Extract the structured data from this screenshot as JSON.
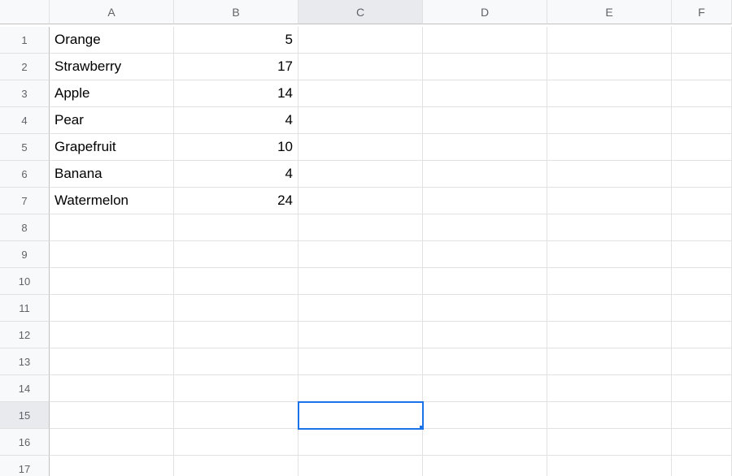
{
  "columns": [
    "A",
    "B",
    "C",
    "D",
    "E",
    "F"
  ],
  "rowCount": 17,
  "activeCell": {
    "col": "C",
    "row": 15
  },
  "cells": {
    "A1": {
      "v": "Orange",
      "t": "txt"
    },
    "B1": {
      "v": "5",
      "t": "num"
    },
    "A2": {
      "v": "Strawberry",
      "t": "txt"
    },
    "B2": {
      "v": "17",
      "t": "num"
    },
    "A3": {
      "v": "Apple",
      "t": "txt"
    },
    "B3": {
      "v": "14",
      "t": "num"
    },
    "A4": {
      "v": "Pear",
      "t": "txt"
    },
    "B4": {
      "v": "4",
      "t": "num"
    },
    "A5": {
      "v": "Grapefruit",
      "t": "txt"
    },
    "B5": {
      "v": "10",
      "t": "num"
    },
    "A6": {
      "v": "Banana",
      "t": "txt"
    },
    "B6": {
      "v": "4",
      "t": "num"
    },
    "A7": {
      "v": "Watermelon",
      "t": "txt"
    },
    "B7": {
      "v": "24",
      "t": "num"
    }
  }
}
